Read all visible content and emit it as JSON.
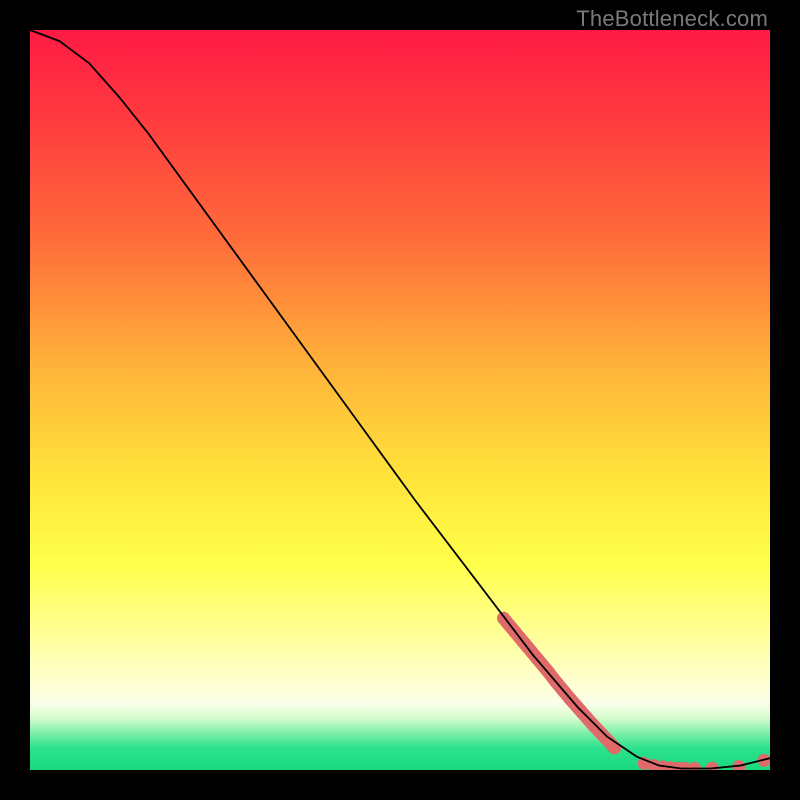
{
  "watermark": "TheBottleneck.com",
  "chart_data": {
    "type": "line",
    "title": "",
    "xlabel": "",
    "ylabel": "",
    "xlim": [
      0,
      100
    ],
    "ylim": [
      0,
      100
    ],
    "background_gradient": {
      "stops": [
        {
          "pct": 0,
          "color": "#ff1a44"
        },
        {
          "pct": 12,
          "color": "#ff3b3f"
        },
        {
          "pct": 28,
          "color": "#ff6b3a"
        },
        {
          "pct": 45,
          "color": "#ffb13a"
        },
        {
          "pct": 60,
          "color": "#ffe23a"
        },
        {
          "pct": 72,
          "color": "#ffff4a"
        },
        {
          "pct": 82,
          "color": "#ffff9a"
        },
        {
          "pct": 88,
          "color": "#ffffcf"
        },
        {
          "pct": 91,
          "color": "#f9ffe8"
        },
        {
          "pct": 93,
          "color": "#d4fccd"
        },
        {
          "pct": 95,
          "color": "#7ef0a8"
        },
        {
          "pct": 97,
          "color": "#2de28e"
        },
        {
          "pct": 100,
          "color": "#18d97f"
        }
      ]
    },
    "series": [
      {
        "name": "curve",
        "stroke": "#000",
        "stroke_width": 1.8,
        "x": [
          0,
          4,
          8,
          12,
          16,
          20,
          28,
          36,
          44,
          52,
          60,
          68,
          74,
          78,
          82,
          85,
          88,
          92,
          96,
          100
        ],
        "y": [
          100,
          98.5,
          95.5,
          91,
          86,
          80.5,
          69.5,
          58.5,
          47.5,
          36.5,
          26,
          15.5,
          8.5,
          4.5,
          1.8,
          0.6,
          0.2,
          0.2,
          0.6,
          1.6
        ]
      }
    ],
    "dots": {
      "color": "#e06a6a",
      "radius": 6.5,
      "cluster_segment": {
        "x": [
          64,
          65.5,
          67,
          68.5,
          70,
          71,
          72,
          73,
          74.5,
          76,
          77.5,
          79
        ],
        "y": [
          20.5,
          18.7,
          16.9,
          15.1,
          13.3,
          12.0,
          10.8,
          9.6,
          7.9,
          6.2,
          4.6,
          3.0
        ]
      },
      "bottom_points": [
        {
          "x": 83.0,
          "y": 0.9
        },
        {
          "x": 84.3,
          "y": 0.6
        },
        {
          "x": 85.5,
          "y": 0.4
        },
        {
          "x": 86.5,
          "y": 0.3
        },
        {
          "x": 87.5,
          "y": 0.25
        },
        {
          "x": 88.5,
          "y": 0.22
        },
        {
          "x": 89.8,
          "y": 0.22
        },
        {
          "x": 92.2,
          "y": 0.25
        },
        {
          "x": 95.8,
          "y": 0.45
        },
        {
          "x": 99.2,
          "y": 1.3
        }
      ]
    }
  }
}
